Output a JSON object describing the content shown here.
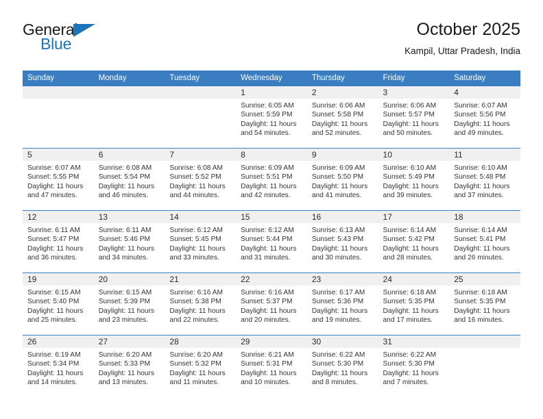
{
  "brand": {
    "name_part1": "General",
    "name_part2": "Blue",
    "logo_icon": "triangle-flag-icon",
    "accent_color": "#1b75bb"
  },
  "header": {
    "title": "October 2025",
    "subtitle": "Kampil, Uttar Pradesh, India"
  },
  "theme": {
    "header_blue": "#3b7dc1",
    "daynum_band": "#f0f0f0",
    "text": "#333333"
  },
  "calendar": {
    "weekday_headers": [
      "Sunday",
      "Monday",
      "Tuesday",
      "Wednesday",
      "Thursday",
      "Friday",
      "Saturday"
    ],
    "weeks": [
      [
        {
          "day": "",
          "empty": true,
          "sunrise": "",
          "sunset": "",
          "daylight1": "",
          "daylight2": ""
        },
        {
          "day": "",
          "empty": true,
          "sunrise": "",
          "sunset": "",
          "daylight1": "",
          "daylight2": ""
        },
        {
          "day": "",
          "empty": true,
          "sunrise": "",
          "sunset": "",
          "daylight1": "",
          "daylight2": ""
        },
        {
          "day": "1",
          "empty": false,
          "sunrise": "Sunrise: 6:05 AM",
          "sunset": "Sunset: 5:59 PM",
          "daylight1": "Daylight: 11 hours",
          "daylight2": "and 54 minutes."
        },
        {
          "day": "2",
          "empty": false,
          "sunrise": "Sunrise: 6:06 AM",
          "sunset": "Sunset: 5:58 PM",
          "daylight1": "Daylight: 11 hours",
          "daylight2": "and 52 minutes."
        },
        {
          "day": "3",
          "empty": false,
          "sunrise": "Sunrise: 6:06 AM",
          "sunset": "Sunset: 5:57 PM",
          "daylight1": "Daylight: 11 hours",
          "daylight2": "and 50 minutes."
        },
        {
          "day": "4",
          "empty": false,
          "sunrise": "Sunrise: 6:07 AM",
          "sunset": "Sunset: 5:56 PM",
          "daylight1": "Daylight: 11 hours",
          "daylight2": "and 49 minutes."
        }
      ],
      [
        {
          "day": "5",
          "empty": false,
          "sunrise": "Sunrise: 6:07 AM",
          "sunset": "Sunset: 5:55 PM",
          "daylight1": "Daylight: 11 hours",
          "daylight2": "and 47 minutes."
        },
        {
          "day": "6",
          "empty": false,
          "sunrise": "Sunrise: 6:08 AM",
          "sunset": "Sunset: 5:54 PM",
          "daylight1": "Daylight: 11 hours",
          "daylight2": "and 46 minutes."
        },
        {
          "day": "7",
          "empty": false,
          "sunrise": "Sunrise: 6:08 AM",
          "sunset": "Sunset: 5:52 PM",
          "daylight1": "Daylight: 11 hours",
          "daylight2": "and 44 minutes."
        },
        {
          "day": "8",
          "empty": false,
          "sunrise": "Sunrise: 6:09 AM",
          "sunset": "Sunset: 5:51 PM",
          "daylight1": "Daylight: 11 hours",
          "daylight2": "and 42 minutes."
        },
        {
          "day": "9",
          "empty": false,
          "sunrise": "Sunrise: 6:09 AM",
          "sunset": "Sunset: 5:50 PM",
          "daylight1": "Daylight: 11 hours",
          "daylight2": "and 41 minutes."
        },
        {
          "day": "10",
          "empty": false,
          "sunrise": "Sunrise: 6:10 AM",
          "sunset": "Sunset: 5:49 PM",
          "daylight1": "Daylight: 11 hours",
          "daylight2": "and 39 minutes."
        },
        {
          "day": "11",
          "empty": false,
          "sunrise": "Sunrise: 6:10 AM",
          "sunset": "Sunset: 5:48 PM",
          "daylight1": "Daylight: 11 hours",
          "daylight2": "and 37 minutes."
        }
      ],
      [
        {
          "day": "12",
          "empty": false,
          "sunrise": "Sunrise: 6:11 AM",
          "sunset": "Sunset: 5:47 PM",
          "daylight1": "Daylight: 11 hours",
          "daylight2": "and 36 minutes."
        },
        {
          "day": "13",
          "empty": false,
          "sunrise": "Sunrise: 6:11 AM",
          "sunset": "Sunset: 5:46 PM",
          "daylight1": "Daylight: 11 hours",
          "daylight2": "and 34 minutes."
        },
        {
          "day": "14",
          "empty": false,
          "sunrise": "Sunrise: 6:12 AM",
          "sunset": "Sunset: 5:45 PM",
          "daylight1": "Daylight: 11 hours",
          "daylight2": "and 33 minutes."
        },
        {
          "day": "15",
          "empty": false,
          "sunrise": "Sunrise: 6:12 AM",
          "sunset": "Sunset: 5:44 PM",
          "daylight1": "Daylight: 11 hours",
          "daylight2": "and 31 minutes."
        },
        {
          "day": "16",
          "empty": false,
          "sunrise": "Sunrise: 6:13 AM",
          "sunset": "Sunset: 5:43 PM",
          "daylight1": "Daylight: 11 hours",
          "daylight2": "and 30 minutes."
        },
        {
          "day": "17",
          "empty": false,
          "sunrise": "Sunrise: 6:14 AM",
          "sunset": "Sunset: 5:42 PM",
          "daylight1": "Daylight: 11 hours",
          "daylight2": "and 28 minutes."
        },
        {
          "day": "18",
          "empty": false,
          "sunrise": "Sunrise: 6:14 AM",
          "sunset": "Sunset: 5:41 PM",
          "daylight1": "Daylight: 11 hours",
          "daylight2": "and 26 minutes."
        }
      ],
      [
        {
          "day": "19",
          "empty": false,
          "sunrise": "Sunrise: 6:15 AM",
          "sunset": "Sunset: 5:40 PM",
          "daylight1": "Daylight: 11 hours",
          "daylight2": "and 25 minutes."
        },
        {
          "day": "20",
          "empty": false,
          "sunrise": "Sunrise: 6:15 AM",
          "sunset": "Sunset: 5:39 PM",
          "daylight1": "Daylight: 11 hours",
          "daylight2": "and 23 minutes."
        },
        {
          "day": "21",
          "empty": false,
          "sunrise": "Sunrise: 6:16 AM",
          "sunset": "Sunset: 5:38 PM",
          "daylight1": "Daylight: 11 hours",
          "daylight2": "and 22 minutes."
        },
        {
          "day": "22",
          "empty": false,
          "sunrise": "Sunrise: 6:16 AM",
          "sunset": "Sunset: 5:37 PM",
          "daylight1": "Daylight: 11 hours",
          "daylight2": "and 20 minutes."
        },
        {
          "day": "23",
          "empty": false,
          "sunrise": "Sunrise: 6:17 AM",
          "sunset": "Sunset: 5:36 PM",
          "daylight1": "Daylight: 11 hours",
          "daylight2": "and 19 minutes."
        },
        {
          "day": "24",
          "empty": false,
          "sunrise": "Sunrise: 6:18 AM",
          "sunset": "Sunset: 5:35 PM",
          "daylight1": "Daylight: 11 hours",
          "daylight2": "and 17 minutes."
        },
        {
          "day": "25",
          "empty": false,
          "sunrise": "Sunrise: 6:18 AM",
          "sunset": "Sunset: 5:35 PM",
          "daylight1": "Daylight: 11 hours",
          "daylight2": "and 16 minutes."
        }
      ],
      [
        {
          "day": "26",
          "empty": false,
          "sunrise": "Sunrise: 6:19 AM",
          "sunset": "Sunset: 5:34 PM",
          "daylight1": "Daylight: 11 hours",
          "daylight2": "and 14 minutes."
        },
        {
          "day": "27",
          "empty": false,
          "sunrise": "Sunrise: 6:20 AM",
          "sunset": "Sunset: 5:33 PM",
          "daylight1": "Daylight: 11 hours",
          "daylight2": "and 13 minutes."
        },
        {
          "day": "28",
          "empty": false,
          "sunrise": "Sunrise: 6:20 AM",
          "sunset": "Sunset: 5:32 PM",
          "daylight1": "Daylight: 11 hours",
          "daylight2": "and 11 minutes."
        },
        {
          "day": "29",
          "empty": false,
          "sunrise": "Sunrise: 6:21 AM",
          "sunset": "Sunset: 5:31 PM",
          "daylight1": "Daylight: 11 hours",
          "daylight2": "and 10 minutes."
        },
        {
          "day": "30",
          "empty": false,
          "sunrise": "Sunrise: 6:22 AM",
          "sunset": "Sunset: 5:30 PM",
          "daylight1": "Daylight: 11 hours",
          "daylight2": "and 8 minutes."
        },
        {
          "day": "31",
          "empty": false,
          "sunrise": "Sunrise: 6:22 AM",
          "sunset": "Sunset: 5:30 PM",
          "daylight1": "Daylight: 11 hours",
          "daylight2": "and 7 minutes."
        },
        {
          "day": "",
          "empty": true,
          "sunrise": "",
          "sunset": "",
          "daylight1": "",
          "daylight2": ""
        }
      ]
    ]
  }
}
